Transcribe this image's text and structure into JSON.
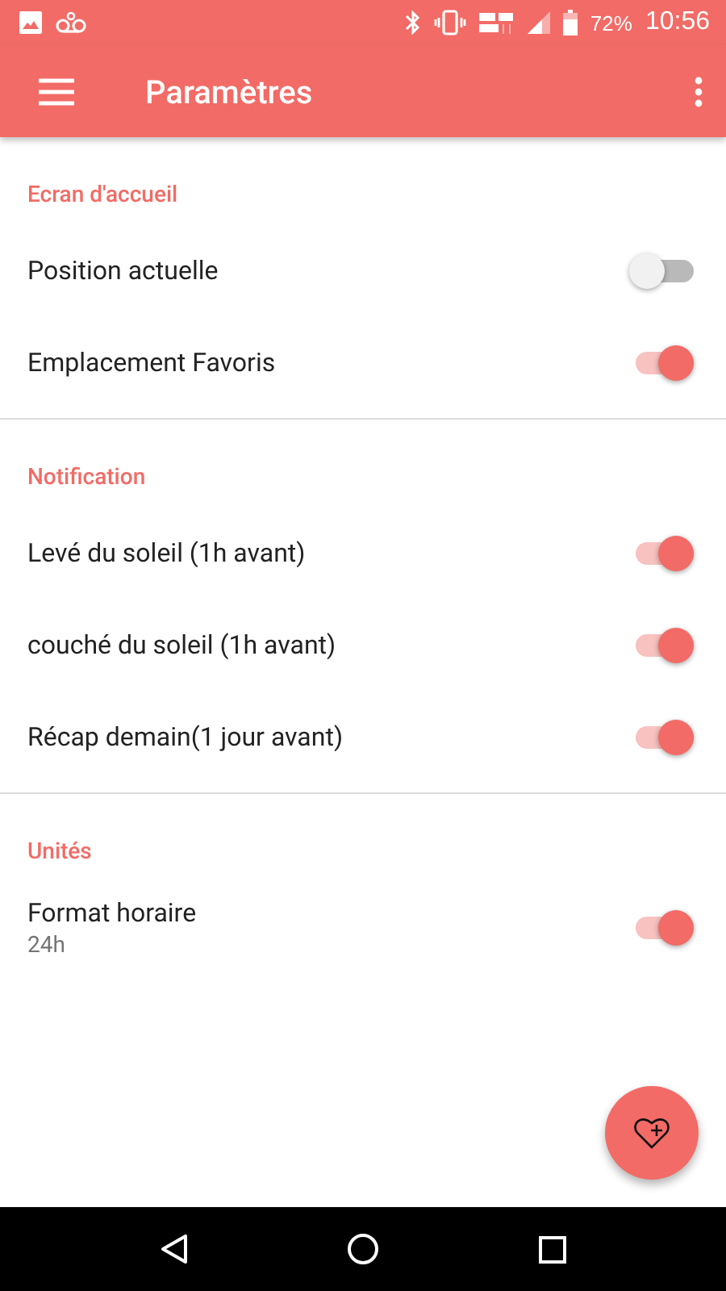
{
  "status_bar": {
    "battery": "72%",
    "time": "10:56"
  },
  "toolbar": {
    "title": "Paramètres"
  },
  "sections": [
    {
      "title": "Ecran d'accueil",
      "items": [
        {
          "label": "Position actuelle",
          "on": false
        },
        {
          "label": "Emplacement Favoris",
          "on": true
        }
      ]
    },
    {
      "title": "Notification",
      "items": [
        {
          "label": "Levé du soleil (1h avant)",
          "on": true
        },
        {
          "label": "couché du soleil (1h avant)",
          "on": true
        },
        {
          "label": "Récap demain(1 jour avant)",
          "on": true
        }
      ]
    },
    {
      "title": "Unités",
      "items": [
        {
          "label": "Format horaire",
          "summary": "24h",
          "on": true
        }
      ]
    }
  ]
}
